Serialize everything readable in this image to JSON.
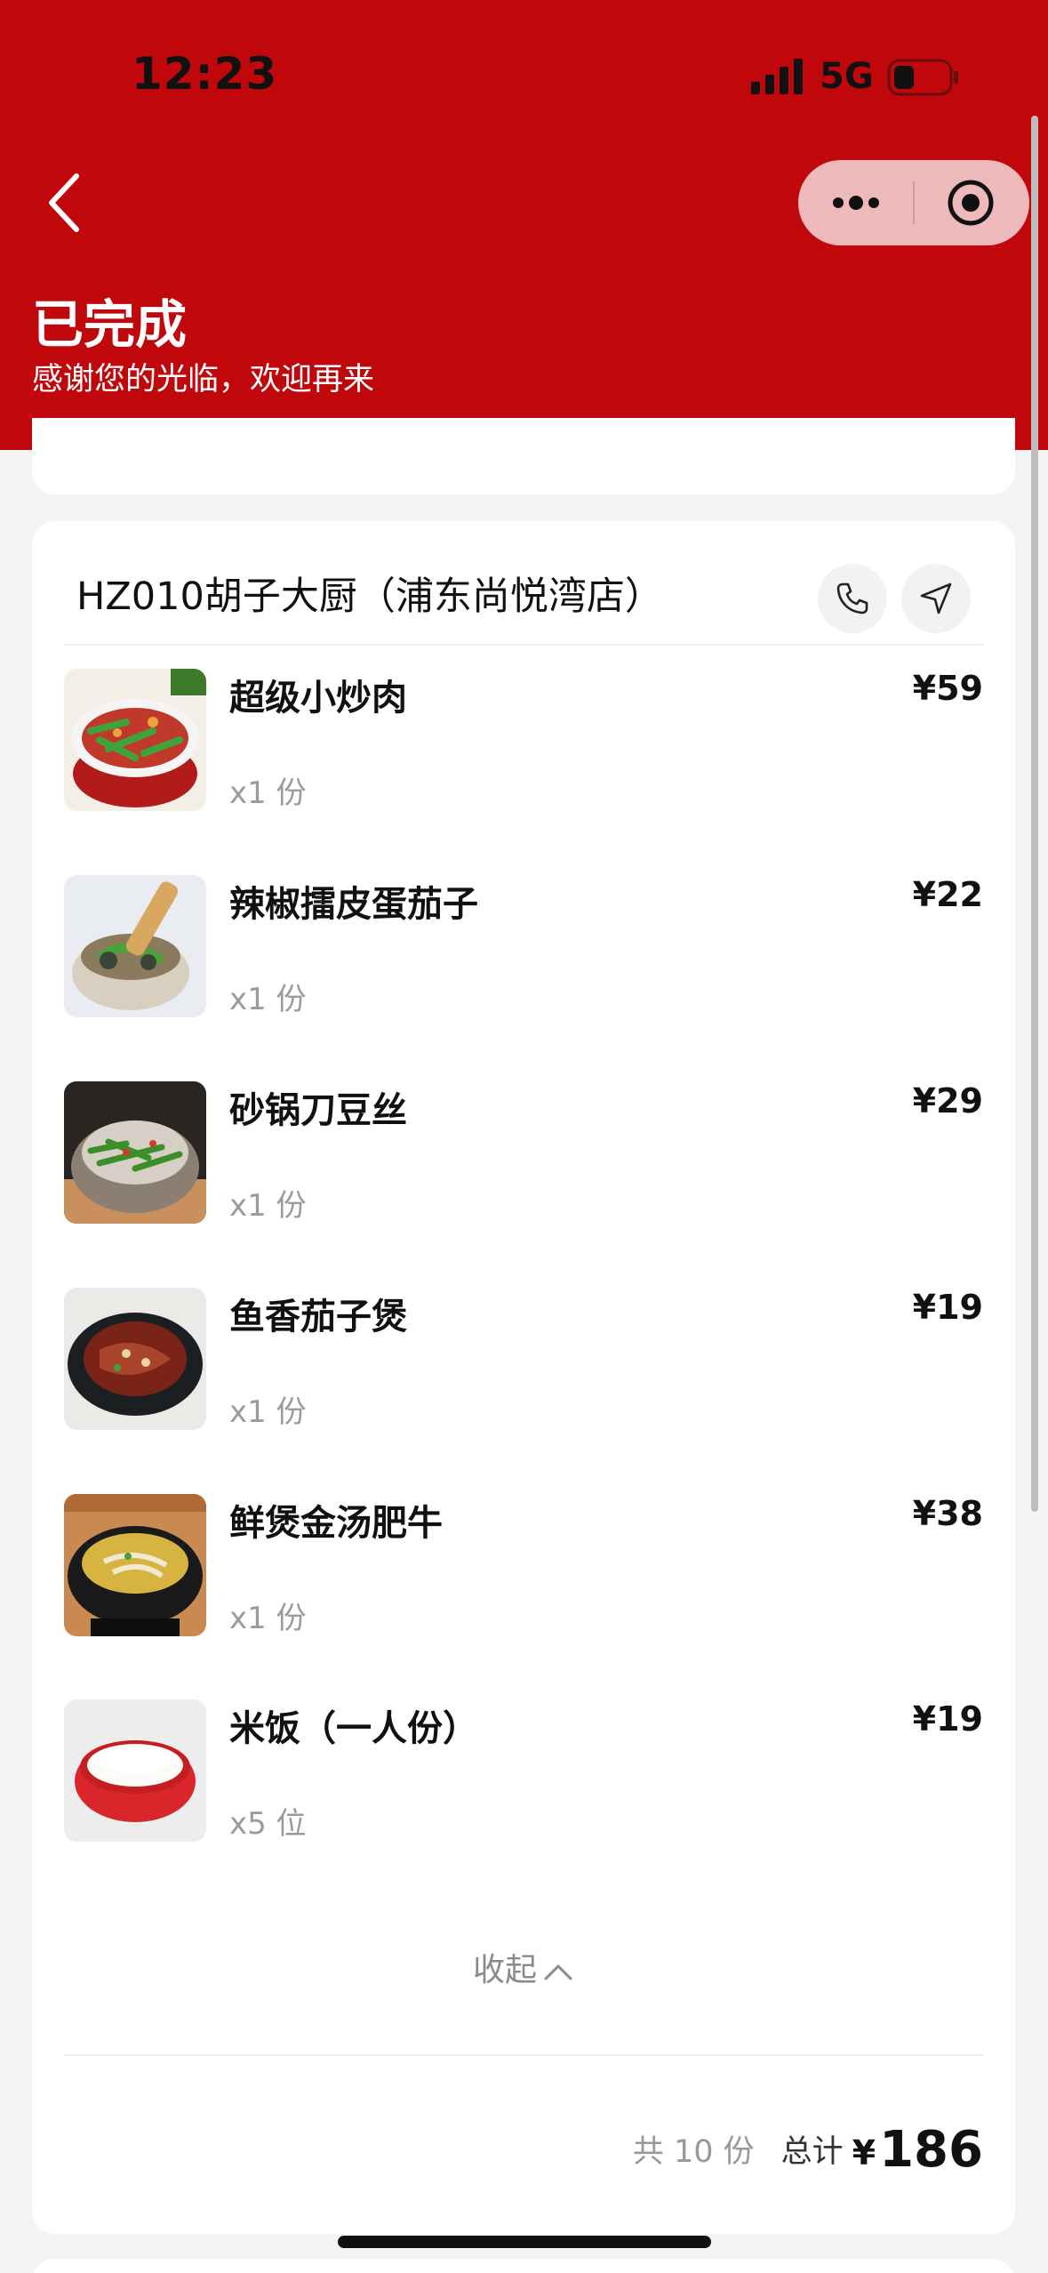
{
  "status_bar": {
    "time": "12:23",
    "network": "5G"
  },
  "header": {
    "title": "已完成",
    "subtitle": "感谢您的光临，欢迎再来"
  },
  "order": {
    "store_name": "HZ010胡子大厨（浦东尚悦湾店）",
    "items": [
      {
        "name": "超级小炒肉",
        "price": "¥59",
        "qty": "x1 份"
      },
      {
        "name": "辣椒擂皮蛋茄子",
        "price": "¥22",
        "qty": "x1 份"
      },
      {
        "name": "砂锅刀豆丝",
        "price": "¥29",
        "qty": "x1 份"
      },
      {
        "name": "鱼香茄子煲",
        "price": "¥19",
        "qty": "x1 份"
      },
      {
        "name": "鲜煲金汤肥牛",
        "price": "¥38",
        "qty": "x1 份"
      },
      {
        "name": "米饭（一人份）",
        "price": "¥19",
        "qty": "x5 位"
      }
    ],
    "collapse_label": "收起",
    "count_text": "共 10 份",
    "total_label": "总计",
    "total_currency": "¥",
    "total_value": "186"
  },
  "colors": {
    "brand_red": "#c0070b",
    "background": "#f4f4f4"
  },
  "icons": [
    "back-icon",
    "more-icon",
    "target-icon",
    "phone-icon",
    "navigate-icon",
    "chevron-up-icon"
  ]
}
